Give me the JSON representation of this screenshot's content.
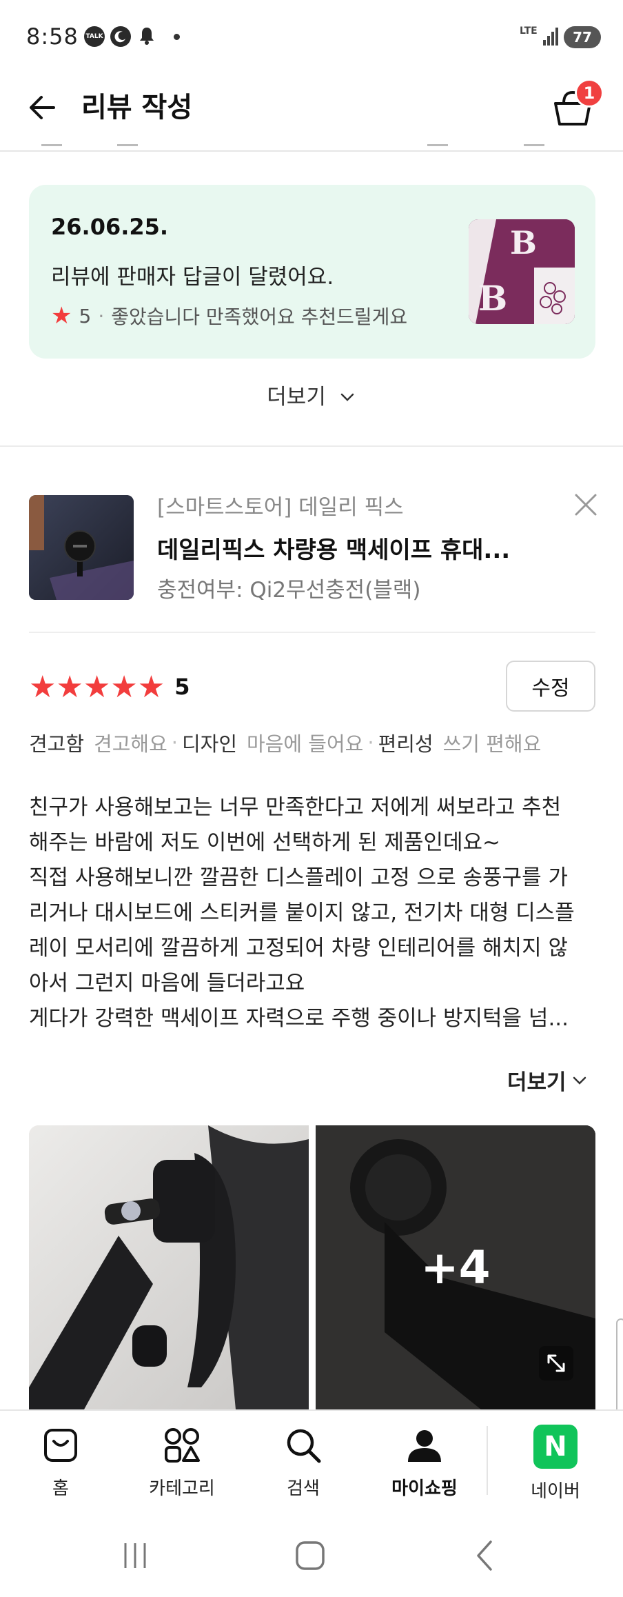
{
  "status_bar": {
    "time": "8:58",
    "talk_badge": "TALK",
    "network": "LTE",
    "battery": "77"
  },
  "header": {
    "title": "리뷰 작성",
    "cart_count": "1"
  },
  "reply_notice": {
    "date": "26.06.25.",
    "message": "리뷰에 판매자 답글이 달렸어요.",
    "rating": "5",
    "review_snippet": "좋았습니다 만족했어요 추천드릴게요"
  },
  "more_label": "더보기",
  "product": {
    "store": "[스마트스토어] 데일리 픽스",
    "name": "데일리픽스 차량용 맥세이프 휴대...",
    "option": "충전여부: Qi2무선충전(블랙)"
  },
  "review": {
    "score": "5",
    "edit_label": "수정",
    "attributes": [
      {
        "key": "견고함",
        "value": "견고해요"
      },
      {
        "key": "디자인",
        "value": "마음에 들어요"
      },
      {
        "key": "편리성",
        "value": "쓰기 편해요"
      }
    ],
    "text_lines": [
      "친구가 사용해보고는 너무 만족한다고 저에게 써보라고 추천",
      "해주는 바람에 저도 이번에 선택하게 된 제품인데요~",
      "직접 사용해보니깐 깔끔한 디스플레이 고정 으로 송풍구를 가",
      "리거나 대시보드에 스티커를 붙이지 않고, 전기차 대형 디스플",
      "레이 모서리에 깔끔하게 고정되어 차량 인테리어를 해치지 않",
      "아서 그런지 마음에 들더라고요",
      "게다가 강력한 맥세이프 자력으로 주행 중이나 방지턱을 넘..."
    ],
    "more_label": "더보기",
    "extra_photos": "+4"
  },
  "bottom_nav": {
    "items": [
      {
        "label": "홈",
        "icon": "home-bag-icon"
      },
      {
        "label": "카테고리",
        "icon": "category-icon"
      },
      {
        "label": "검색",
        "icon": "search-icon"
      },
      {
        "label": "마이쇼핑",
        "icon": "person-icon"
      },
      {
        "label": "네이버",
        "icon": "naver-icon"
      }
    ],
    "naver_letter": "N"
  },
  "colors": {
    "accent_red": "#f23d3d",
    "reply_bg": "#e8f8f0",
    "naver_green": "#10c45a"
  }
}
